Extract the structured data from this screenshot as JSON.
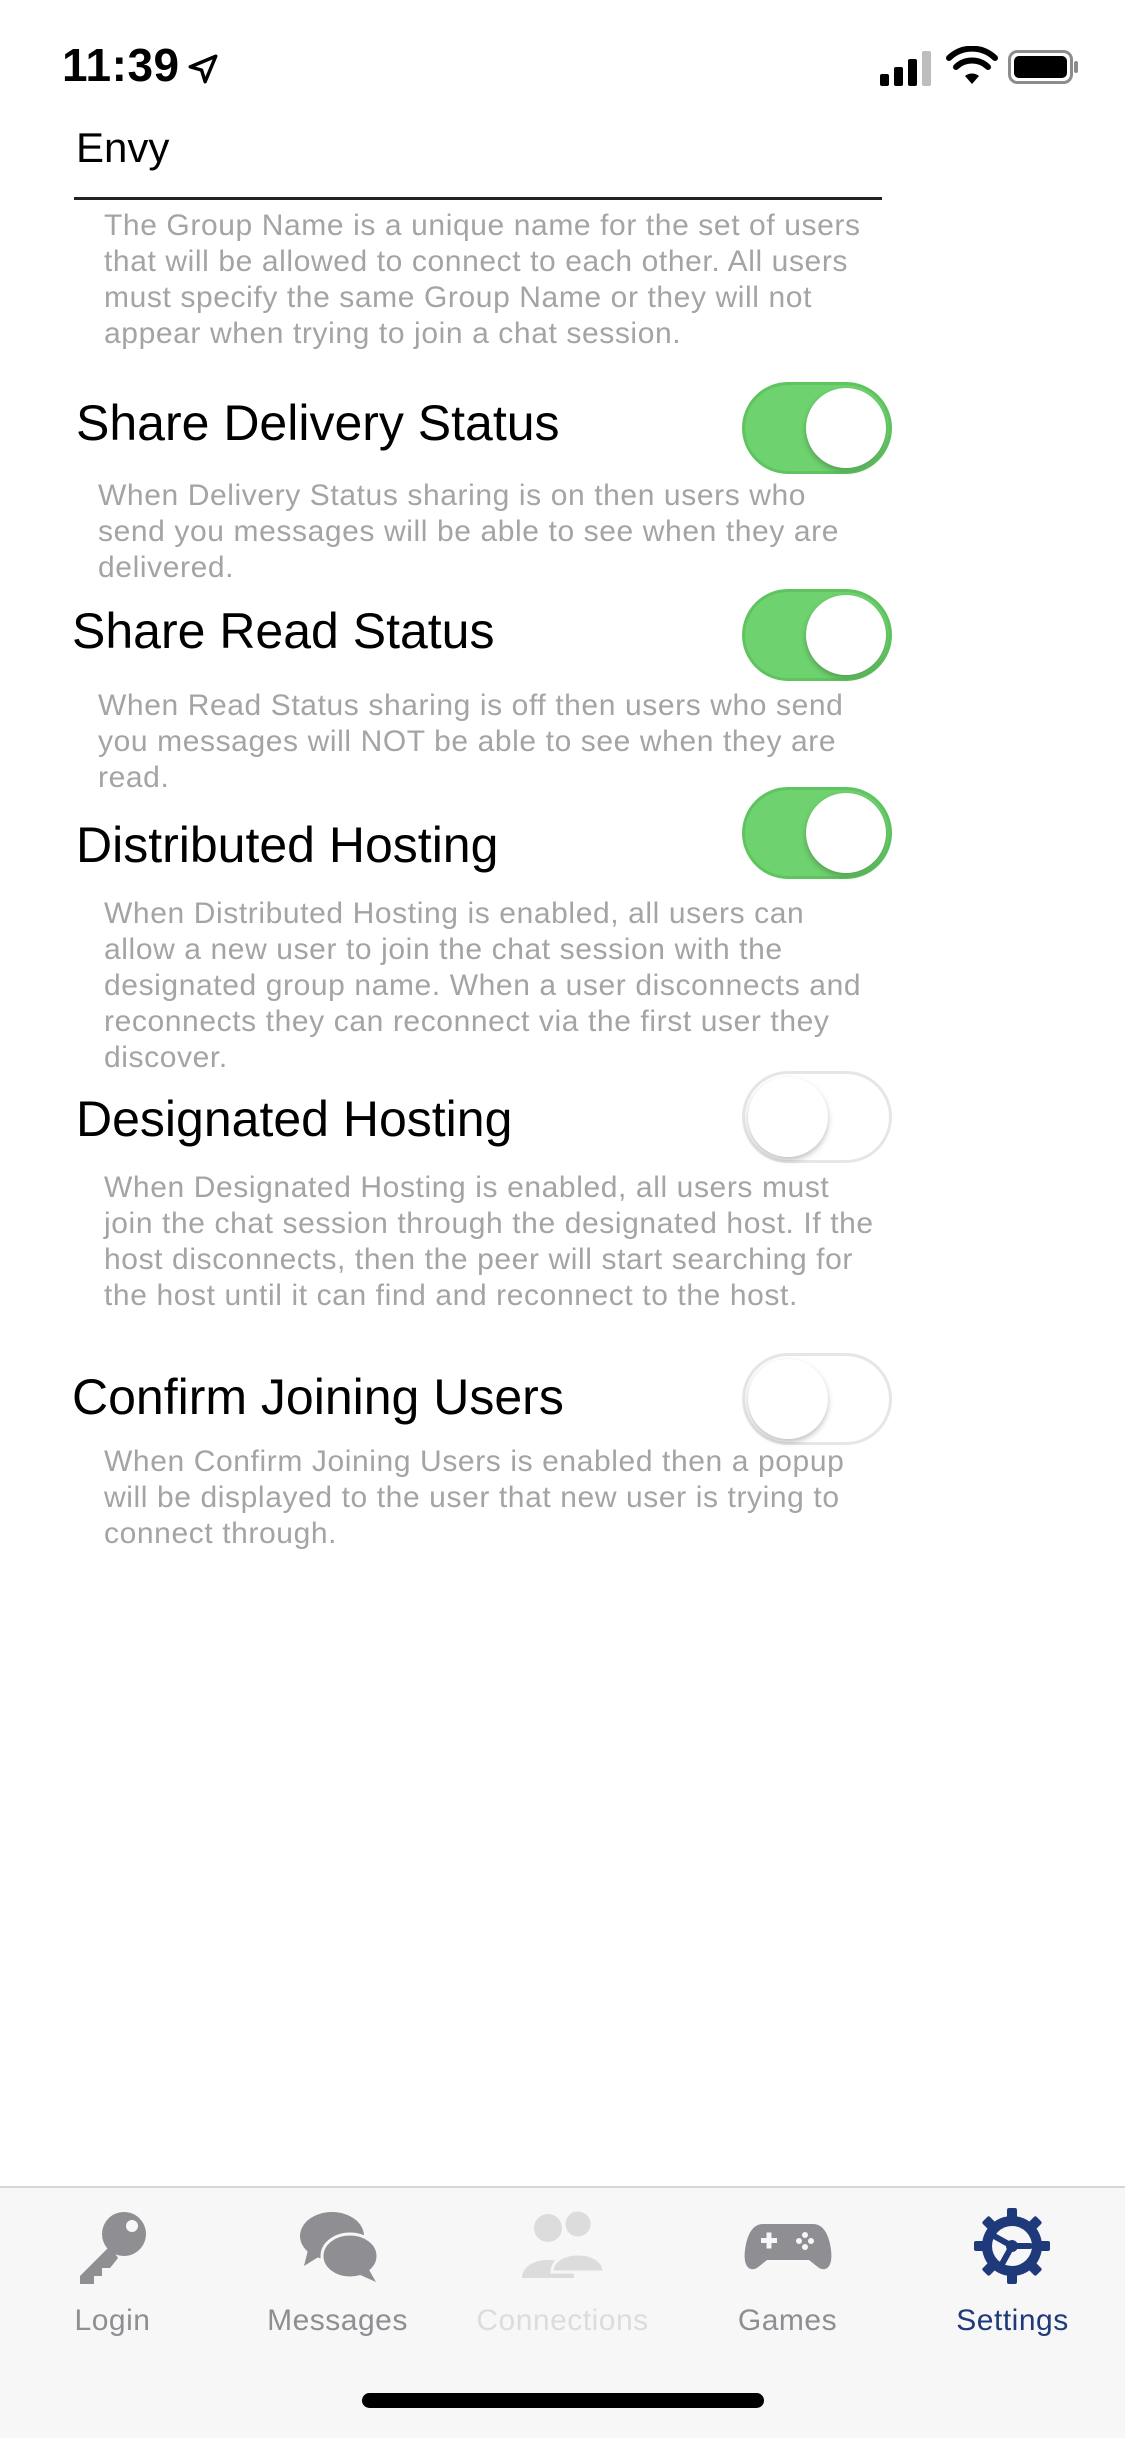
{
  "status_bar": {
    "time": "11:39"
  },
  "group_name": {
    "value": "Envy",
    "description": "The Group Name is a unique name for the set of users that will be allowed to connect to each other. All users must specify the same Group Name or they will not appear when trying to join a chat session."
  },
  "settings": [
    {
      "label": "Share Delivery Status",
      "on": true,
      "description": "When Delivery Status sharing is on then users who send you messages will be able to see when they are delivered."
    },
    {
      "label": "Share Read Status",
      "on": true,
      "description": "When Read Status sharing is off then users who send you messages will NOT be able to see when they are read."
    },
    {
      "label": "Distributed Hosting",
      "on": true,
      "description": "When Distributed Hosting is enabled, all users can allow a new user to join the chat session with the designated group name. When a user disconnects and reconnects they can reconnect via the first user they discover."
    },
    {
      "label": "Designated Hosting",
      "on": false,
      "description": "When Designated Hosting is enabled, all users must join the chat session through the designated host. If the host disconnects, then the peer will start searching for the host until it can find and reconnect to the host."
    },
    {
      "label": "Confirm Joining Users",
      "on": false,
      "description": "When Confirm Joining Users is enabled then a popup will be displayed to the user that new user is trying to connect through."
    }
  ],
  "tabs": [
    {
      "label": "Login",
      "icon": "key-icon",
      "state": "normal"
    },
    {
      "label": "Messages",
      "icon": "chat-bubbles-icon",
      "state": "normal"
    },
    {
      "label": "Connections",
      "icon": "people-icon",
      "state": "disabled"
    },
    {
      "label": "Games",
      "icon": "gamepad-icon",
      "state": "normal"
    },
    {
      "label": "Settings",
      "icon": "gear-icon",
      "state": "active"
    }
  ],
  "colors": {
    "toggle_on": "#6ed26e",
    "description_text": "#a4a4a4",
    "tab_inactive": "#8e8e93",
    "tab_active": "#1f3a7a"
  }
}
